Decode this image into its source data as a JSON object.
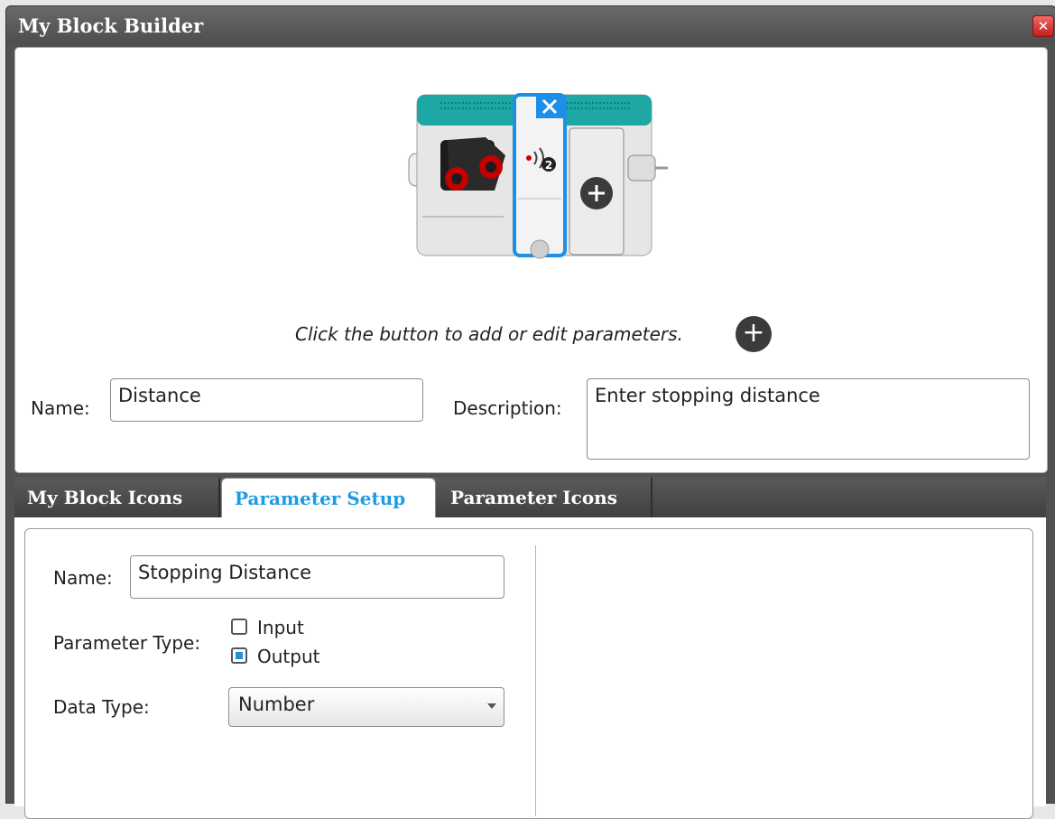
{
  "window": {
    "title": "My Block Builder",
    "close_glyph": "✕"
  },
  "preview": {
    "hint": "Click the button to add or edit parameters.",
    "plus_glyph": "+",
    "param_badge": "2"
  },
  "block_info": {
    "name_label": "Name:",
    "name_value": "Distance",
    "description_label": "Description:",
    "description_value": "Enter stopping distance"
  },
  "tabs": [
    {
      "label": "My Block Icons",
      "active": false
    },
    {
      "label": "Parameter Setup",
      "active": true
    },
    {
      "label": "Parameter Icons",
      "active": false
    }
  ],
  "parameter_setup": {
    "name_label": "Name:",
    "name_value": "Stopping Distance",
    "param_type_label": "Parameter Type:",
    "options": [
      {
        "label": "Input",
        "checked": false
      },
      {
        "label": "Output",
        "checked": true
      }
    ],
    "data_type_label": "Data Type:",
    "data_type_value": "Number"
  },
  "colors": {
    "accent": "#1e9be6",
    "block_header": "#19a6a3"
  },
  "icons": [
    "close-icon",
    "ultrasonic-sensor-icon",
    "output-parameter-icon",
    "add-parameter-icon",
    "dropdown-arrow-icon"
  ]
}
